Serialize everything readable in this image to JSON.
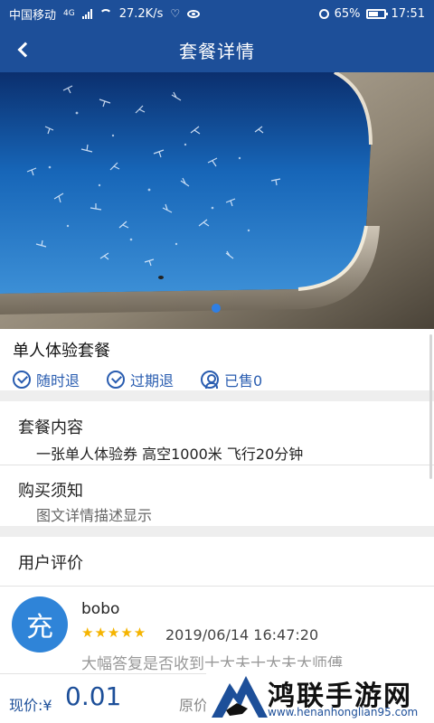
{
  "status_bar": {
    "carrier": "中国移动",
    "network": "4G",
    "speed": "27.2K/s",
    "battery": "65%",
    "time": "17:51"
  },
  "nav": {
    "title": "套餐详情"
  },
  "carousel": {
    "active_index": 0,
    "dots": 1
  },
  "package": {
    "title": "单人体验套餐",
    "tags": [
      "随时退",
      "过期退",
      "已售0"
    ]
  },
  "content_section": {
    "label": "套餐内容",
    "text": "一张单人体验券 高空1000米 飞行20分钟"
  },
  "notice_section": {
    "label": "购买须知",
    "text": "图文详情描述显示"
  },
  "reviews_section": {
    "label": "用户评价",
    "items": [
      {
        "avatar_char": "充",
        "name": "bobo",
        "stars": "★★★★★",
        "rating": 5,
        "date": "2019/06/14 16:47:20",
        "text": "大幅答复是否收到十大夫十大夫大师傅"
      }
    ]
  },
  "bottom_bar": {
    "price_label": "现价:¥",
    "price_value": "0.01",
    "original_label": "原价"
  },
  "watermark": {
    "name": "鸿联手游网",
    "url": "www.henanhonglian95.com"
  },
  "colors": {
    "primary": "#1d4f99",
    "accent": "#2a5db0",
    "star": "#f5b400",
    "avatar": "#2f84d8"
  }
}
